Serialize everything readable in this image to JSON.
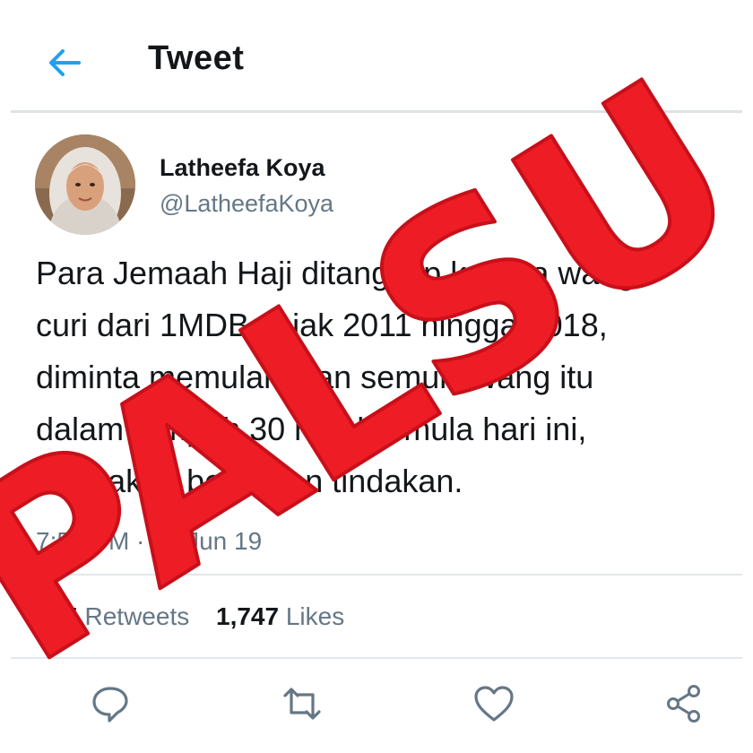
{
  "header": {
    "back_icon": "arrow-left-icon",
    "title": "Tweet"
  },
  "user": {
    "name": "Latheefa Koya",
    "handle": "@LatheefaKoya",
    "avatar_icon": "avatar-photo"
  },
  "tweet": {
    "text": "Para Jemaah Haji ditangkap kerana wang\ncuri dari 1MDB sejak 2011 hingga 2018,\ndiminta memulangkan semula wang itu\ndalam tempoh 30 hari bermula hari ini,\natau akan berdepan tindakan.",
    "timestamp": "7:50 PM · 22 Jun 19"
  },
  "stats": {
    "retweets_count": "875",
    "retweets_label": "Retweets",
    "likes_count": "1,747",
    "likes_label": "Likes"
  },
  "actions": [
    {
      "icon": "reply-icon"
    },
    {
      "icon": "retweet-icon"
    },
    {
      "icon": "heart-icon"
    },
    {
      "icon": "share-icon"
    }
  ],
  "overlay": {
    "stamp_text": "PALSU",
    "stamp_color": "#ee1c25"
  },
  "colors": {
    "accent": "#1da1f2",
    "secondary_text": "#657786",
    "divider": "#e1e8ed"
  }
}
